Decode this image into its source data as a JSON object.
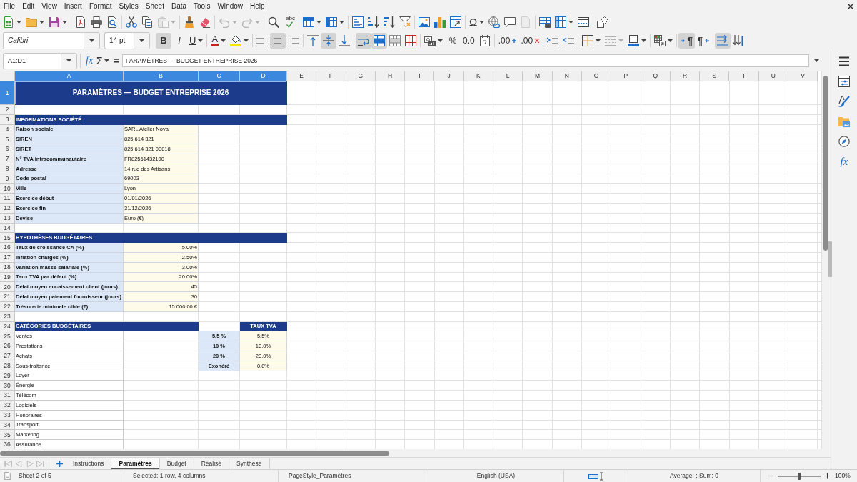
{
  "menu_bar": [
    "File",
    "Edit",
    "View",
    "Insert",
    "Format",
    "Styles",
    "Sheet",
    "Data",
    "Tools",
    "Window",
    "Help"
  ],
  "standard_toolbar": {
    "groups": [
      [
        {
          "kind": "new",
          "dropdown": true,
          "disabled": false
        },
        {
          "kind": "open",
          "dropdown": true,
          "disabled": false
        },
        {
          "kind": "save",
          "dropdown": true,
          "disabled": false
        }
      ],
      [
        {
          "kind": "pdf",
          "dropdown": false,
          "disabled": false
        },
        {
          "kind": "print",
          "dropdown": false,
          "disabled": false
        },
        {
          "kind": "preview",
          "dropdown": false,
          "disabled": false
        }
      ],
      [
        {
          "kind": "cut",
          "dropdown": false,
          "disabled": false
        },
        {
          "kind": "copy",
          "dropdown": false,
          "disabled": false
        },
        {
          "kind": "paste",
          "dropdown": true,
          "disabled": true
        }
      ],
      [
        {
          "kind": "clone",
          "dropdown": false,
          "disabled": false
        },
        {
          "kind": "clear",
          "dropdown": false,
          "disabled": false
        }
      ],
      [
        {
          "kind": "undo",
          "dropdown": true,
          "disabled": true
        },
        {
          "kind": "redo",
          "dropdown": true,
          "disabled": true
        }
      ],
      [
        {
          "kind": "find",
          "dropdown": false,
          "disabled": false
        },
        {
          "kind": "spelling",
          "label": "abc",
          "dropdown": false,
          "disabled": false
        }
      ],
      [
        {
          "kind": "rows",
          "dropdown": true,
          "disabled": false
        },
        {
          "kind": "columns",
          "dropdown": true,
          "disabled": false
        }
      ],
      [
        {
          "kind": "sort",
          "dropdown": false,
          "disabled": false
        },
        {
          "kind": "sort_asc",
          "dropdown": false,
          "disabled": false
        },
        {
          "kind": "sort_desc",
          "dropdown": false,
          "disabled": false
        },
        {
          "kind": "autofilter",
          "dropdown": false,
          "disabled": false
        }
      ],
      [
        {
          "kind": "image",
          "dropdown": false,
          "disabled": false
        },
        {
          "kind": "chart",
          "dropdown": false,
          "disabled": false
        },
        {
          "kind": "pivot",
          "dropdown": false,
          "disabled": false
        }
      ],
      [
        {
          "kind": "special_char",
          "label": "Ω",
          "dropdown": true,
          "disabled": false
        },
        {
          "kind": "hyperlink",
          "dropdown": false,
          "disabled": false
        },
        {
          "kind": "comment",
          "dropdown": false,
          "disabled": false
        },
        {
          "kind": "header_footer",
          "dropdown": false,
          "disabled": true
        }
      ],
      [
        {
          "kind": "print_area",
          "dropdown": false,
          "disabled": false
        },
        {
          "kind": "freeze",
          "dropdown": true,
          "disabled": false
        },
        {
          "kind": "split",
          "dropdown": false,
          "disabled": false
        }
      ],
      [
        {
          "kind": "shapes",
          "dropdown": false,
          "disabled": false
        }
      ]
    ]
  },
  "formatting_toolbar": {
    "font_name": "Calibri",
    "font_size": "14 pt",
    "groups": [
      [
        {
          "kind": "bold",
          "label": "B",
          "dropdown": false,
          "active": true,
          "disabled": false
        },
        {
          "kind": "italic",
          "label": "I",
          "dropdown": false,
          "active": false,
          "disabled": false
        },
        {
          "kind": "underline",
          "label": "U",
          "dropdown": true,
          "active": false,
          "disabled": false
        }
      ],
      [
        {
          "kind": "font_color",
          "label": "A",
          "dropdown": true,
          "active": false,
          "disabled": false
        },
        {
          "kind": "highlight",
          "dropdown": true,
          "active": false,
          "disabled": false
        }
      ],
      [
        {
          "kind": "align_left",
          "dropdown": false,
          "active": false,
          "disabled": false
        },
        {
          "kind": "align_center",
          "dropdown": false,
          "active": true,
          "disabled": false
        },
        {
          "kind": "align_right",
          "dropdown": false,
          "active": false,
          "disabled": false
        }
      ],
      [
        {
          "kind": "align_top",
          "dropdown": false,
          "active": false,
          "disabled": false
        },
        {
          "kind": "align_middle",
          "dropdown": false,
          "active": true,
          "disabled": false
        },
        {
          "kind": "align_bottom",
          "dropdown": false,
          "active": false,
          "disabled": false
        }
      ],
      [
        {
          "kind": "wrap",
          "dropdown": false,
          "active": true,
          "disabled": false
        },
        {
          "kind": "merge_center",
          "dropdown": false,
          "active": true,
          "disabled": false
        },
        {
          "kind": "merge",
          "dropdown": false,
          "active": false,
          "disabled": false
        },
        {
          "kind": "unmerge",
          "dropdown": false,
          "active": false,
          "disabled": false
        }
      ],
      [
        {
          "kind": "currency",
          "dropdown": true,
          "active": false,
          "disabled": false
        },
        {
          "kind": "percent",
          "label": "%",
          "dropdown": false,
          "active": false,
          "disabled": false
        },
        {
          "kind": "number",
          "label": "0.0",
          "dropdown": false,
          "active": false,
          "disabled": false
        },
        {
          "kind": "date",
          "dropdown": false,
          "active": false,
          "disabled": false
        }
      ],
      [
        {
          "kind": "add_decimal",
          "label": ".00",
          "dropdown": false,
          "active": false,
          "disabled": false
        },
        {
          "kind": "delete_decimal",
          "label": ".00",
          "dropdown": false,
          "active": false,
          "disabled": false
        }
      ],
      [
        {
          "kind": "indent_more",
          "dropdown": false,
          "active": false,
          "disabled": false
        },
        {
          "kind": "indent_less",
          "dropdown": false,
          "active": false,
          "disabled": false
        }
      ],
      [
        {
          "kind": "borders",
          "dropdown": true,
          "active": false,
          "disabled": false
        },
        {
          "kind": "border_style",
          "dropdown": true,
          "active": false,
          "disabled": true
        },
        {
          "kind": "border_color",
          "dropdown": true,
          "active": false,
          "disabled": false
        }
      ],
      [
        {
          "kind": "conditional",
          "dropdown": true,
          "active": false,
          "disabled": false
        }
      ],
      [
        {
          "kind": "ltr",
          "label": "¶",
          "dropdown": false,
          "active": true,
          "disabled": false
        },
        {
          "kind": "rtl",
          "label": "¶",
          "dropdown": false,
          "active": false,
          "disabled": false
        }
      ],
      [
        {
          "kind": "text_ltr",
          "dropdown": false,
          "active": true,
          "disabled": false
        },
        {
          "kind": "text_vertical",
          "dropdown": false,
          "active": false,
          "disabled": false
        }
      ]
    ]
  },
  "formula_bar": {
    "name_box": "A1:D1",
    "wizard": "fx",
    "sum": "Σ",
    "equals": "=",
    "content": "PARAMÈTRES — BUDGET ENTREPRISE 2026"
  },
  "sidebar": {
    "tabs": [
      {
        "kind": "properties"
      },
      {
        "kind": "styles"
      },
      {
        "kind": "gallery"
      },
      {
        "kind": "navigator"
      },
      {
        "kind": "functions",
        "label": "fx"
      }
    ]
  },
  "sheet": {
    "columns": [
      {
        "label": "A",
        "selected": true
      },
      {
        "label": "B",
        "selected": true
      },
      {
        "label": "C",
        "selected": true
      },
      {
        "label": "D",
        "selected": true
      },
      {
        "label": "E",
        "selected": false
      },
      {
        "label": "F",
        "selected": false
      },
      {
        "label": "G",
        "selected": false
      },
      {
        "label": "H",
        "selected": false
      },
      {
        "label": "I",
        "selected": false
      },
      {
        "label": "J",
        "selected": false
      },
      {
        "label": "K",
        "selected": false
      },
      {
        "label": "L",
        "selected": false
      },
      {
        "label": "M",
        "selected": false
      },
      {
        "label": "N",
        "selected": false
      },
      {
        "label": "O",
        "selected": false
      },
      {
        "label": "P",
        "selected": false
      },
      {
        "label": "Q",
        "selected": false
      },
      {
        "label": "R",
        "selected": false
      },
      {
        "label": "S",
        "selected": false
      },
      {
        "label": "T",
        "selected": false
      },
      {
        "label": "U",
        "selected": false
      },
      {
        "label": "V",
        "selected": false
      }
    ],
    "rows": [
      {
        "number": "1",
        "selected": true,
        "cells": [
          {
            "kind": "title",
            "text": "PARAMÈTRES — BUDGET ENTREPRISE 2026"
          },
          {
            "kind": "merged"
          },
          {
            "kind": "merged"
          },
          {
            "kind": "merged"
          }
        ]
      },
      {
        "number": "2",
        "selected": false
      },
      {
        "number": "3",
        "selected": false,
        "cells": [
          {
            "kind": "section",
            "text": "INFORMATIONS SOCIÉTÉ"
          },
          {
            "kind": "merged"
          },
          {
            "kind": "merged"
          },
          {
            "kind": "merged"
          }
        ]
      },
      {
        "number": "4",
        "selected": false,
        "cells": [
          {
            "kind": "label",
            "text": "Raison sociale"
          },
          {
            "kind": "value",
            "text": "SARL Atelier Nova"
          }
        ]
      },
      {
        "number": "5",
        "selected": false,
        "cells": [
          {
            "kind": "label",
            "text": "SIREN"
          },
          {
            "kind": "value",
            "text": "825 614 321"
          }
        ]
      },
      {
        "number": "6",
        "selected": false,
        "cells": [
          {
            "kind": "label",
            "text": "SIRET"
          },
          {
            "kind": "value",
            "text": "825 614 321 00018"
          }
        ]
      },
      {
        "number": "7",
        "selected": false,
        "cells": [
          {
            "kind": "label",
            "text": "N° TVA intracommunautaire"
          },
          {
            "kind": "value",
            "text": "FR82561432100"
          }
        ]
      },
      {
        "number": "8",
        "selected": false,
        "cells": [
          {
            "kind": "label",
            "text": "Adresse"
          },
          {
            "kind": "value",
            "text": "14 rue des Artisans"
          }
        ]
      },
      {
        "number": "9",
        "selected": false,
        "cells": [
          {
            "kind": "label",
            "text": "Code postal"
          },
          {
            "kind": "value",
            "text": "69003"
          }
        ]
      },
      {
        "number": "10",
        "selected": false,
        "cells": [
          {
            "kind": "label",
            "text": "Ville"
          },
          {
            "kind": "value",
            "text": "Lyon"
          }
        ]
      },
      {
        "number": "11",
        "selected": false,
        "cells": [
          {
            "kind": "label",
            "text": "Exercice début"
          },
          {
            "kind": "value",
            "text": "01/01/2026"
          }
        ]
      },
      {
        "number": "12",
        "selected": false,
        "cells": [
          {
            "kind": "label",
            "text": "Exercice fin"
          },
          {
            "kind": "value",
            "text": "31/12/2026"
          }
        ]
      },
      {
        "number": "13",
        "selected": false,
        "cells": [
          {
            "kind": "label",
            "text": "Devise"
          },
          {
            "kind": "value",
            "text": "Euro (€)"
          }
        ]
      },
      {
        "number": "14",
        "selected": false
      },
      {
        "number": "15",
        "selected": false,
        "cells": [
          {
            "kind": "section",
            "text": "HYPOTHÈSES BUDGÉTAIRES"
          },
          {
            "kind": "merged"
          },
          {
            "kind": "merged"
          },
          {
            "kind": "merged"
          }
        ]
      },
      {
        "number": "16",
        "selected": false,
        "cells": [
          {
            "kind": "label",
            "text": "Taux de croissance CA (%)"
          },
          {
            "kind": "number",
            "text": "5.00%"
          }
        ]
      },
      {
        "number": "17",
        "selected": false,
        "cells": [
          {
            "kind": "label",
            "text": "Inflation charges (%)"
          },
          {
            "kind": "number",
            "text": "2.50%"
          }
        ]
      },
      {
        "number": "18",
        "selected": false,
        "cells": [
          {
            "kind": "label",
            "text": "Variation masse salariale (%)"
          },
          {
            "kind": "number",
            "text": "3.00%"
          }
        ]
      },
      {
        "number": "19",
        "selected": false,
        "cells": [
          {
            "kind": "label",
            "text": "Taux TVA par défaut (%)"
          },
          {
            "kind": "number",
            "text": "20.00%"
          }
        ]
      },
      {
        "number": "20",
        "selected": false,
        "cells": [
          {
            "kind": "label",
            "text": "Délai moyen encaissement client (jours)"
          },
          {
            "kind": "number",
            "text": "45"
          }
        ]
      },
      {
        "number": "21",
        "selected": false,
        "cells": [
          {
            "kind": "label",
            "text": "Délai moyen paiement fournisseur (jours)"
          },
          {
            "kind": "number",
            "text": "30"
          }
        ]
      },
      {
        "number": "22",
        "selected": false,
        "cells": [
          {
            "kind": "label",
            "text": "Trésorerie minimale cible (€)"
          },
          {
            "kind": "number",
            "text": "15 000.00 €"
          }
        ]
      },
      {
        "number": "23",
        "selected": false
      },
      {
        "number": "24",
        "selected": false,
        "cells": [
          {
            "kind": "section",
            "text": "CATÉGORIES BUDGÉTAIRES"
          },
          {
            "kind": "merged"
          },
          {
            "kind": "blank"
          },
          {
            "kind": "column_header",
            "text": "TAUX TVA"
          }
        ]
      },
      {
        "number": "25",
        "selected": false,
        "cells": [
          {
            "kind": "category",
            "text": "Ventes"
          },
          {
            "kind": "blank"
          },
          {
            "kind": "rate_label",
            "text": "5,5 %"
          },
          {
            "kind": "rate",
            "text": "5.5%"
          }
        ]
      },
      {
        "number": "26",
        "selected": false,
        "cells": [
          {
            "kind": "category",
            "text": "Prestations"
          },
          {
            "kind": "blank"
          },
          {
            "kind": "rate_label",
            "text": "10 %"
          },
          {
            "kind": "rate",
            "text": "10.0%"
          }
        ]
      },
      {
        "number": "27",
        "selected": false,
        "cells": [
          {
            "kind": "category",
            "text": "Achats"
          },
          {
            "kind": "blank"
          },
          {
            "kind": "rate_label",
            "text": "20 %"
          },
          {
            "kind": "rate",
            "text": "20.0%"
          }
        ]
      },
      {
        "number": "28",
        "selected": false,
        "cells": [
          {
            "kind": "category",
            "text": "Sous-traitance"
          },
          {
            "kind": "blank"
          },
          {
            "kind": "rate_label",
            "text": "Exonéré"
          },
          {
            "kind": "rate",
            "text": "0.0%"
          }
        ]
      },
      {
        "number": "29",
        "selected": false,
        "cells": [
          {
            "kind": "category",
            "text": "Loyer"
          }
        ]
      },
      {
        "number": "30",
        "selected": false,
        "cells": [
          {
            "kind": "category",
            "text": "Énergie"
          }
        ]
      },
      {
        "number": "31",
        "selected": false,
        "cells": [
          {
            "kind": "category",
            "text": "Télécom"
          }
        ]
      },
      {
        "number": "32",
        "selected": false,
        "cells": [
          {
            "kind": "category",
            "text": "Logiciels"
          }
        ]
      },
      {
        "number": "33",
        "selected": false,
        "cells": [
          {
            "kind": "category",
            "text": "Honoraires"
          }
        ]
      },
      {
        "number": "34",
        "selected": false,
        "cells": [
          {
            "kind": "category",
            "text": "Transport"
          }
        ]
      },
      {
        "number": "35",
        "selected": false,
        "cells": [
          {
            "kind": "category",
            "text": "Marketing"
          }
        ]
      },
      {
        "number": "36",
        "selected": false,
        "cells": [
          {
            "kind": "category",
            "text": "Assurance"
          }
        ]
      }
    ]
  },
  "sheet_tabs": {
    "tabs": [
      {
        "label": "Instructions",
        "selected": false
      },
      {
        "label": "Paramètres",
        "selected": true
      },
      {
        "label": "Budget",
        "selected": false
      },
      {
        "label": "Réalisé",
        "selected": false
      },
      {
        "label": "Synthèse",
        "selected": false
      }
    ]
  },
  "status_bar": {
    "sheet_position": "Sheet 2 of 5",
    "selection": "Selected: 1 row, 4 columns",
    "page_style": "PageStyle_Paramètres",
    "language": "English (USA)",
    "summary": "Average: ; Sum: 0",
    "zoom": {
      "level": 0.5,
      "reading": "100%"
    }
  }
}
